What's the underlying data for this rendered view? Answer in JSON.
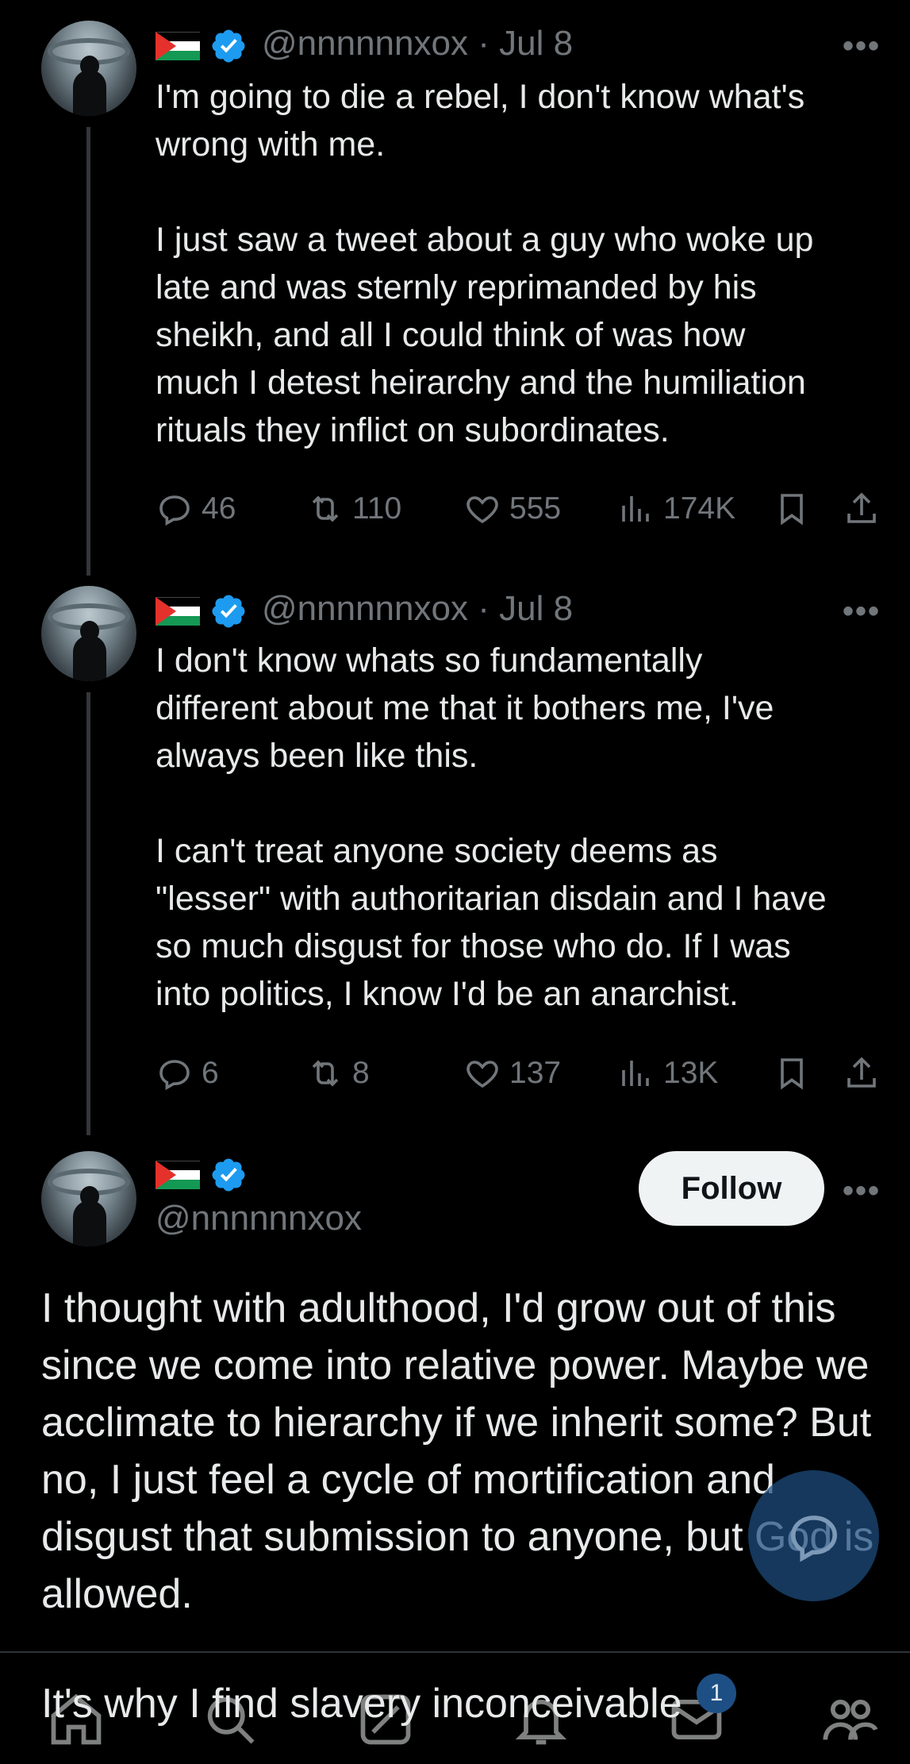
{
  "tweets": [
    {
      "handle": "@nnnnnnxox",
      "separator": "·",
      "date": "Jul 8",
      "text": "I'm going to die a rebel, I don't know what's\nwrong with me.\n\nI just saw a tweet about a guy who woke up\nlate and was sternly reprimanded by his\nsheikh, and all I could think of was how\nmuch I detest heirarchy and the humiliation\nrituals they inflict on subordinates.",
      "replies": "46",
      "reposts": "110",
      "likes": "555",
      "views": "174K"
    },
    {
      "handle": "@nnnnnnxox",
      "separator": "·",
      "date": "Jul 8",
      "text": "I don't know whats so fundamentally\ndifferent about me that it bothers me, I've\nalways been like this.\n\nI can't treat anyone society deems as\n\"lesser\" with authoritarian disdain and I have\nso much disgust for those who do. If I was\ninto politics, I know I'd be an anarchist.",
      "replies": "6",
      "reposts": "8",
      "likes": "137",
      "views": "13K"
    }
  ],
  "main_tweet": {
    "handle": "@nnnnnnxox",
    "follow_label": "Follow",
    "text": "I thought with adulthood, I'd grow out of this\nsince we come into relative power. Maybe we\nacclimate to hierarchy if we inherit some? But\nno, I just feel a cycle of mortification and\ndisgust that submission to anyone, but God is\nallowed.",
    "next_line": "It's why I find slavery inconceivable"
  },
  "more_label": "•••",
  "nav": {
    "items": [
      "home-icon",
      "search-icon",
      "grok-icon",
      "notifications-icon",
      "messages-icon",
      "communities-icon"
    ],
    "messages_badge": "1"
  },
  "colors": {
    "background": "#000000",
    "text": "#e7e9ea",
    "muted": "#71767b",
    "verified": "#1d9bf0",
    "follow_bg": "#eff3f4"
  }
}
